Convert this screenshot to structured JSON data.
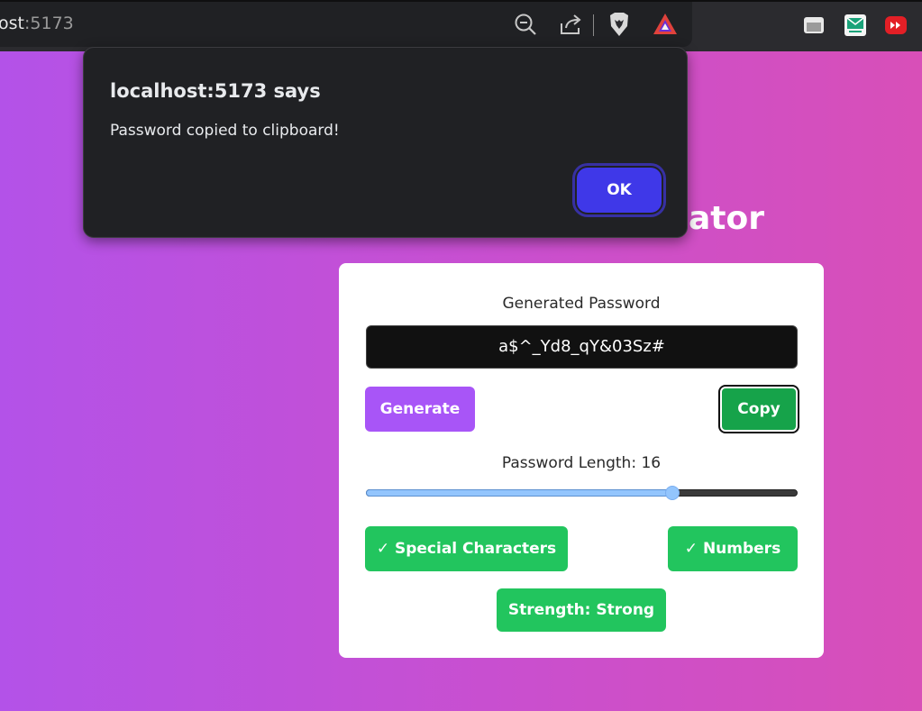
{
  "browser": {
    "url_host": "ost",
    "url_port": ":5173",
    "icons": [
      "zoom-out-icon",
      "share-icon",
      "brave-shields-icon",
      "brave-rewards-icon",
      "tab-icon",
      "mail-extension-icon",
      "youtube-extension-icon"
    ]
  },
  "app": {
    "title": "ator",
    "generated_label": "Generated Password",
    "password": "a$^_Yd8_qY&03Sz#",
    "generate_label": "Generate",
    "copy_label": "Copy",
    "length_label": "Password Length: 16",
    "length": {
      "value": 16,
      "slider_fraction": 0.71
    },
    "special_label": "✓ Special Characters",
    "numbers_label": "✓ Numbers",
    "strength_label": "Strength: Strong",
    "colors": {
      "generate": "#a855f7",
      "copy": "#16a34a",
      "toggle_on": "#22c55e",
      "slider": "#93c5fd"
    }
  },
  "dialog": {
    "title": "localhost:5173 says",
    "message": "Password copied to clipboard!",
    "ok_label": "OK",
    "ok_color": "#3f38e8"
  }
}
